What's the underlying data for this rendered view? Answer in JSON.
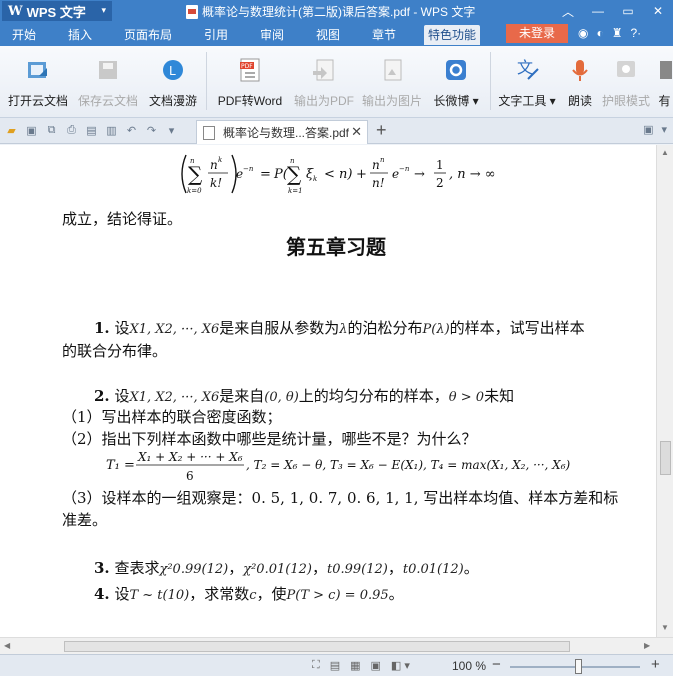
{
  "titlebar": {
    "app_button": "WPS 文字",
    "doc_title": "概率论与数理统计(第二版)课后答案.pdf - WPS 文字"
  },
  "menubar": {
    "items": [
      {
        "label": "开始"
      },
      {
        "label": "插入"
      },
      {
        "label": "页面布局"
      },
      {
        "label": "引用"
      },
      {
        "label": "审阅"
      },
      {
        "label": "视图"
      },
      {
        "label": "章节"
      },
      {
        "label": "特色功能"
      }
    ],
    "login": "未登录"
  },
  "ribbon": {
    "buttons": [
      {
        "label": "打开云文档",
        "icon": "cloud-open-icon",
        "enabled": true
      },
      {
        "label": "保存云文档",
        "icon": "cloud-save-icon",
        "enabled": false
      },
      {
        "label": "文档漫游",
        "icon": "roaming-icon",
        "enabled": true
      },
      {
        "label": "PDF转Word",
        "icon": "pdf-to-word-icon",
        "enabled": true
      },
      {
        "label": "输出为PDF",
        "icon": "export-pdf-icon",
        "enabled": false
      },
      {
        "label": "输出为图片",
        "icon": "export-image-icon",
        "enabled": false
      },
      {
        "label": "长微博",
        "icon": "weibo-icon",
        "enabled": true
      },
      {
        "label": "文字工具",
        "icon": "text-tools-icon",
        "enabled": true
      },
      {
        "label": "朗读",
        "icon": "read-aloud-icon",
        "enabled": true
      },
      {
        "label": "护眼模式",
        "icon": "eye-care-icon",
        "enabled": false
      },
      {
        "label": "有",
        "icon": "more-icon",
        "enabled": true
      }
    ]
  },
  "tabbar": {
    "doc_tab": "概率论与数理...答案.pdf"
  },
  "document": {
    "conclusion": "成立，结论得证。",
    "chapter_title": "第五章习题",
    "q1_num": "1.",
    "q1_text_a": "设",
    "q1_text_b": "是来自服从参数为",
    "q1_text_c": "的泊松分布",
    "q1_text_d": "的样本，试写出样本",
    "q1_line2": "的联合分布律。",
    "q2_num": "2.",
    "q2_text_a": "设",
    "q2_text_b": "是来自",
    "q2_text_c": "上的均匀分布的样本，",
    "q2_text_d": "未知",
    "q2_sub1": "（1）写出样本的联合密度函数；",
    "q2_sub2": "（2）指出下列样本函数中哪些是统计量，哪些不是？为什么？",
    "q2_sub3": "（3）设样本的一组观察是：0. 5, 1, 0. 7, 0. 6, 1, 1, 写出样本均值、样本方差和标",
    "q2_sub3_line2": "准差。",
    "q3_num": "3.",
    "q3_text": "查表求",
    "q3_sep": "，",
    "q3_end": "。",
    "q4_num": "4.",
    "q4_text_a": "设",
    "q4_text_b": "，求常数",
    "q4_text_c": "，使",
    "q4_end": "。"
  },
  "math": {
    "x_seq": "X1, X2, ···, X6",
    "lambda": "λ",
    "poisson": "P(λ)",
    "interval": "(0, θ)",
    "theta_pos": "θ > 0",
    "t_student": "T ~ t(10)",
    "c": "c",
    "prob": "P(T > c) = 0.95",
    "chi1": "χ²0.99(12)",
    "chi2": "χ²0.01(12)",
    "t1": "t0.99(12)",
    "t2": "t0.01(12)"
  },
  "status": {
    "zoom": "100 %",
    "zoom_fraction": 0.5
  }
}
